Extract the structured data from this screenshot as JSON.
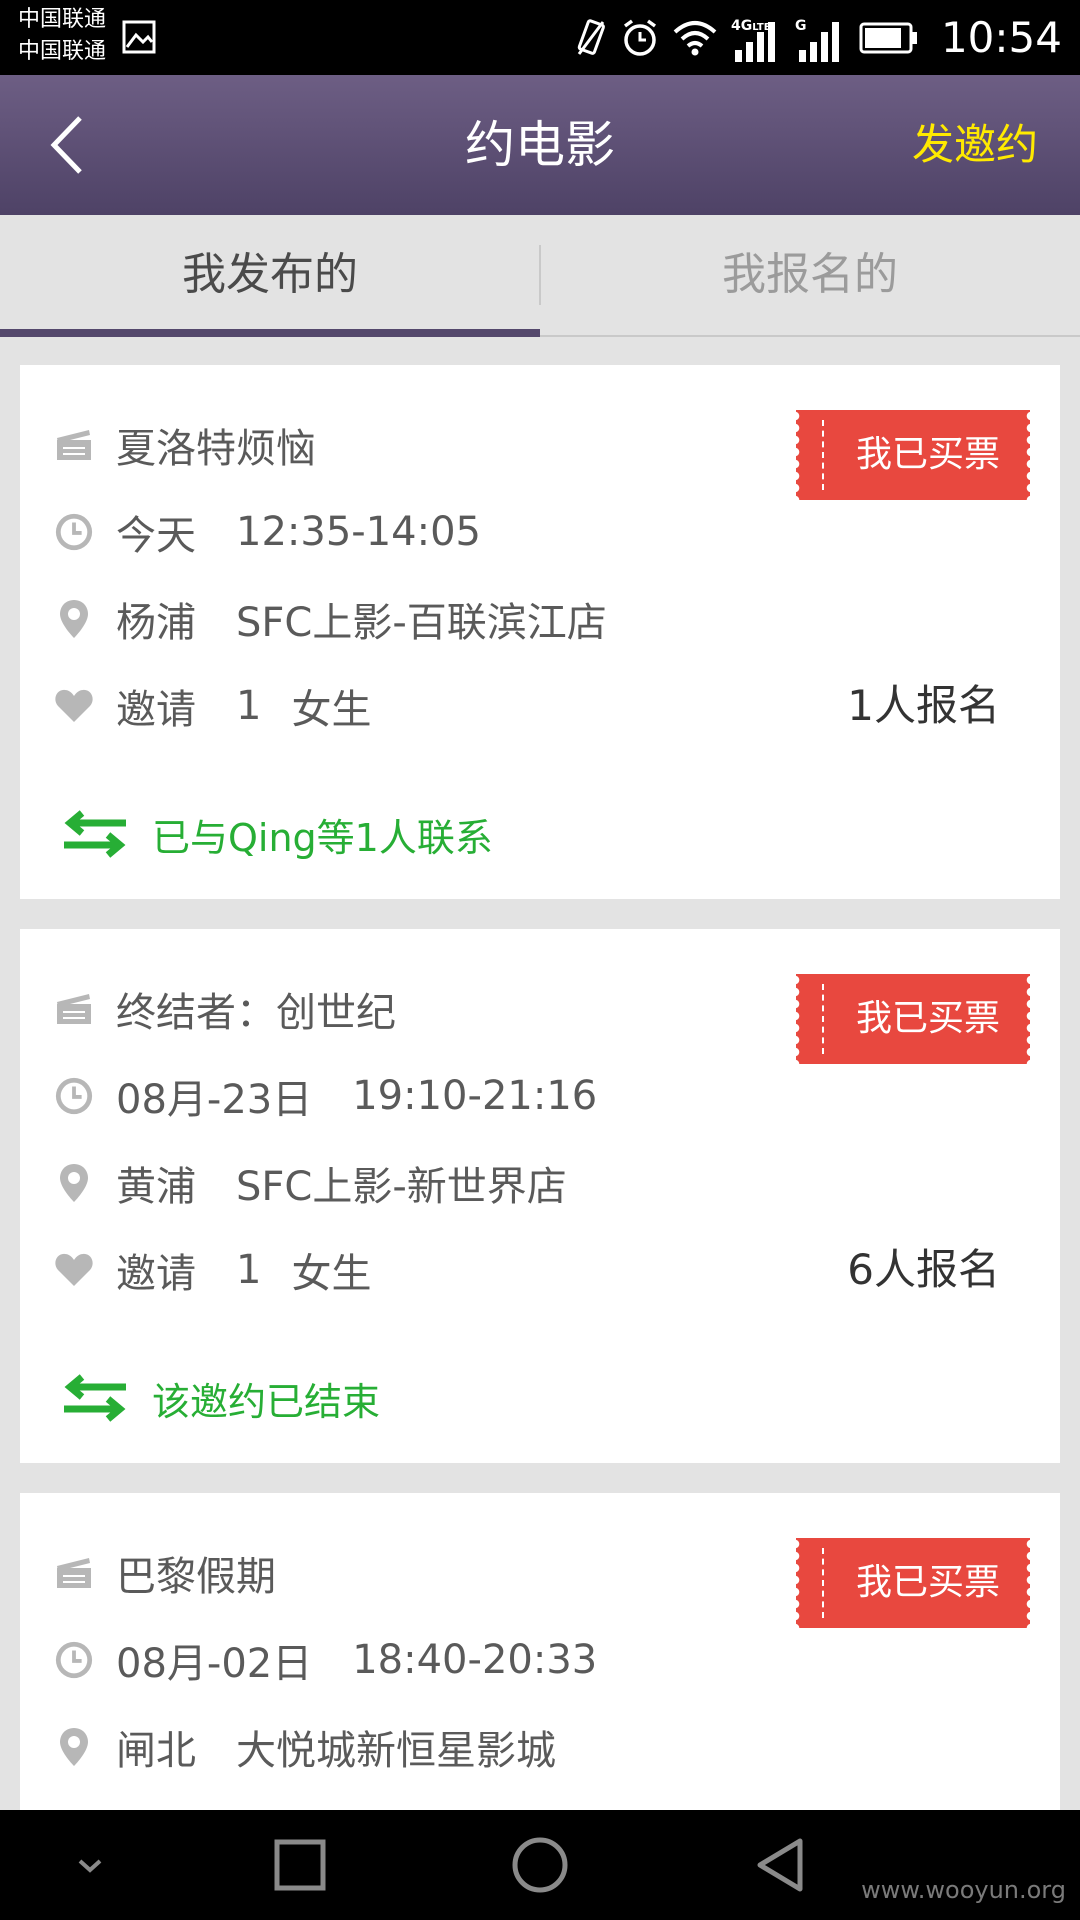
{
  "status_bar": {
    "carrier_1": "中国联通",
    "carrier_2": "中国联通",
    "network_label": "4G",
    "network_label_sub": "LTE",
    "network_label_2": "G",
    "time": "10:54"
  },
  "header": {
    "back_icon": "chevron-left-icon",
    "title": "约电影",
    "invite_label": "发邀约",
    "background": "#5c4f76",
    "invite_color": "#ffea00"
  },
  "tabs": [
    {
      "label": "我发布的",
      "active": true
    },
    {
      "label": "我报名的",
      "active": false
    }
  ],
  "cards": [
    {
      "movie": "夏洛特烦恼",
      "date": "今天",
      "time_range": "12:35-14:05",
      "district": "杨浦",
      "cinema": "SFC上影-百联滨江店",
      "invite_label": "邀请",
      "invite_count": "1",
      "invite_gender": "女生",
      "signup_count": "1人报名",
      "ticket_label": "我已买票",
      "contact_text": "已与Qing等1人联系"
    },
    {
      "movie": "终结者：创世纪",
      "date": "08月-23日",
      "time_range": "19:10-21:16",
      "district": "黄浦",
      "cinema": "SFC上影-新世界店",
      "invite_label": "邀请",
      "invite_count": "1",
      "invite_gender": "女生",
      "signup_count": "6人报名",
      "ticket_label": "我已买票",
      "contact_text": "该邀约已结束"
    },
    {
      "movie": "巴黎假期",
      "date": "08月-02日",
      "time_range": "18:40-20:33",
      "district": "闸北",
      "cinema": "大悦城新恒星影城",
      "ticket_label": "我已买票"
    }
  ],
  "colors": {
    "ticket_red": "#e8483f",
    "contact_green": "#27ae35",
    "tab_indicator": "#54486c"
  },
  "navbar": {
    "buttons": [
      "chevron-down-icon",
      "square-recents-icon",
      "circle-home-icon",
      "triangle-back-icon"
    ],
    "watermark": "www.wooyun.org"
  }
}
